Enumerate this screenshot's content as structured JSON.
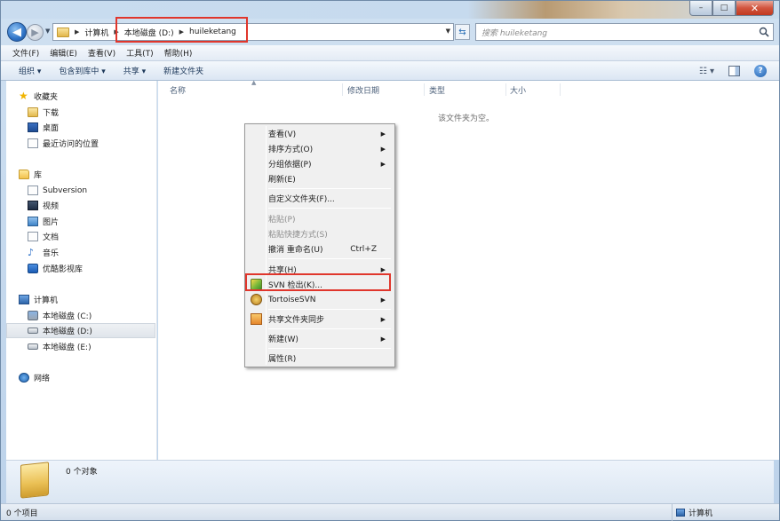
{
  "window": {
    "controls": {
      "minimize": "–",
      "maximize": "□",
      "close": "✕"
    }
  },
  "address": {
    "crumbs": [
      "计算机",
      "本地磁盘 (D:)",
      "huileketang"
    ],
    "search_placeholder": "搜索 huileketang"
  },
  "menubar": [
    "文件(F)",
    "编辑(E)",
    "查看(V)",
    "工具(T)",
    "帮助(H)"
  ],
  "toolbar": {
    "organize": "组织 ▾",
    "include_library": "包含到库中 ▾",
    "share": "共享 ▾",
    "new_folder": "新建文件夹"
  },
  "navpane": {
    "favorites": {
      "header": "收藏夹",
      "items": [
        "下载",
        "桌面",
        "最近访问的位置"
      ]
    },
    "libraries": {
      "header": "库",
      "items": [
        "Subversion",
        "视频",
        "图片",
        "文档",
        "音乐",
        "优酷影视库"
      ]
    },
    "computer": {
      "header": "计算机",
      "items": [
        "本地磁盘 (C:)",
        "本地磁盘 (D:)",
        "本地磁盘 (E:)"
      ]
    },
    "network": {
      "header": "网络"
    }
  },
  "content": {
    "columns": [
      "名称",
      "修改日期",
      "类型",
      "大小"
    ],
    "empty_message": "该文件夹为空。"
  },
  "context_menu": {
    "view": "查看(V)",
    "sort_by": "排序方式(O)",
    "group_by": "分组依据(P)",
    "refresh": "刷新(E)",
    "customize": "自定义文件夹(F)...",
    "paste": "粘贴(P)",
    "paste_shortcut": "粘贴快捷方式(S)",
    "undo_rename": "撤消 重命名(U)",
    "undo_shortcut": "Ctrl+Z",
    "share_with": "共享(H)",
    "svn_checkout": "SVN 检出(K)...",
    "tortoise_svn": "TortoiseSVN",
    "shared_folder_sync": "共享文件夹同步",
    "new": "新建(W)",
    "properties": "属性(R)"
  },
  "details": {
    "object_count": "0 个对象"
  },
  "status": {
    "left": "0 个项目",
    "right": "计算机"
  },
  "colors": {
    "highlight": "#e0362c",
    "accent": "#2f73c6"
  }
}
